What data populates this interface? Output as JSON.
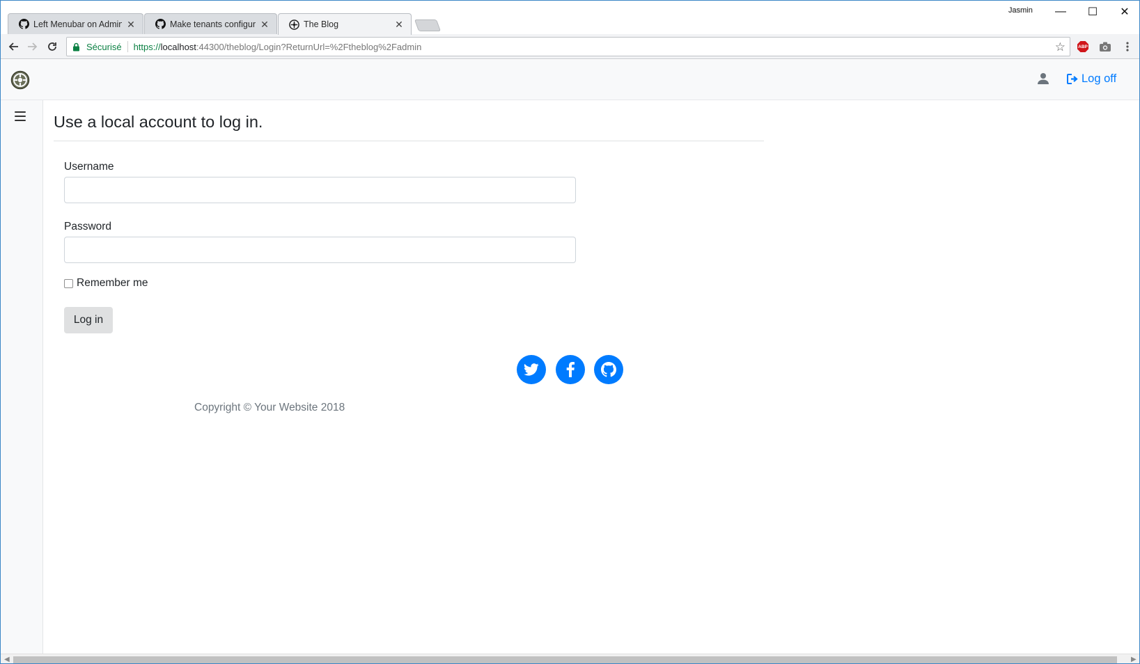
{
  "browser": {
    "tabs": [
      {
        "title": "Left Menubar on Admin l",
        "icon": "github-icon"
      },
      {
        "title": "Make tenants configurab",
        "icon": "github-icon"
      },
      {
        "title": "The Blog",
        "icon": "orchard-icon",
        "active": true
      }
    ],
    "close_glyph": "✕",
    "window_user": "Jasmin",
    "window_buttons": {
      "minimize": "—",
      "maximize": "☐",
      "close": "✕"
    },
    "address": {
      "security_label": "Sécurisé",
      "scheme": "https://",
      "host": "localhost",
      "path": ":44300/theblog/Login?ReturnUrl=%2Ftheblog%2Fadmin"
    },
    "bookmark_glyph": "☆",
    "extensions": [
      "adblock-icon",
      "camera-icon",
      "menu-icon"
    ],
    "adblock_label": "ABP"
  },
  "navbar": {
    "brand_icon": "orchard-logo-icon",
    "user_icon": "user-icon",
    "logoff_label": "Log off"
  },
  "sidebar": {
    "toggle_icon": "hamburger-icon"
  },
  "login": {
    "heading": "Use a local account to log in.",
    "username_label": "Username",
    "username_value": "",
    "password_label": "Password",
    "password_value": "",
    "remember_label": "Remember me",
    "remember_checked": false,
    "submit_label": "Log in"
  },
  "footer": {
    "social": [
      "twitter-icon",
      "facebook-icon",
      "github-icon"
    ],
    "copyright": "Copyright © Your Website 2018"
  },
  "colors": {
    "primary": "#007bff",
    "secure_green": "#0b8043",
    "muted": "#6c757d",
    "button_gray": "#dfe0e1"
  }
}
